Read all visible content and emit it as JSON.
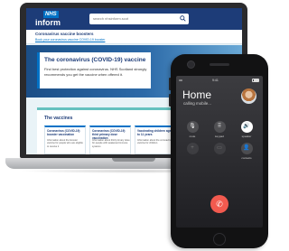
{
  "website": {
    "logo": {
      "nhs": "NHS",
      "inform": "inform"
    },
    "search": {
      "placeholder": "search nhsinform.scot",
      "icon": "search-icon"
    },
    "alert": {
      "title": "Coronavirus vaccine boosters",
      "link": "Book your coronavirus vaccine COVID-19 booster"
    },
    "hero": {
      "title": "The coronavirus (COVID-19) vaccine",
      "body": "Find best protection against coronavirus. NHS Scotland strongly recommends you get the vaccine when offered it."
    },
    "vaccines": {
      "title": "The vaccines",
      "cards": [
        {
          "title": "Coronavirus (COVID-19) booster vaccination",
          "body": "Information about the booster vaccine for people who are eligible to receive it"
        },
        {
          "title": "Coronavirus (COVID-19) third primary dose vaccination",
          "body": "Information about third primary dose for people with weakened immune systems"
        },
        {
          "title": "Vaccinating children aged 5 to 11 years",
          "body": "Information about the coronavirus vaccine for children"
        }
      ]
    }
  },
  "phone": {
    "status_bar": {
      "signal": "•••••",
      "time": "9:41"
    },
    "caller": "Home",
    "call_status": "calling mobile...",
    "controls": [
      {
        "label": "mute",
        "icon": "mute-icon",
        "glyph": "🎙",
        "state": "normal"
      },
      {
        "label": "keypad",
        "icon": "keypad-icon",
        "glyph": "⠿",
        "state": "normal"
      },
      {
        "label": "speaker",
        "icon": "speaker-icon",
        "glyph": "🔊",
        "state": "active"
      },
      {
        "label": "",
        "icon": "add-call-icon",
        "glyph": "+",
        "state": "dim"
      },
      {
        "label": "",
        "icon": "facetime-icon",
        "glyph": "▭",
        "state": "dim"
      },
      {
        "label": "contacts",
        "icon": "contacts-icon",
        "glyph": "👤",
        "state": "normal"
      }
    ],
    "end_call_icon": "end-call-icon",
    "end_call_glyph": "✆"
  }
}
